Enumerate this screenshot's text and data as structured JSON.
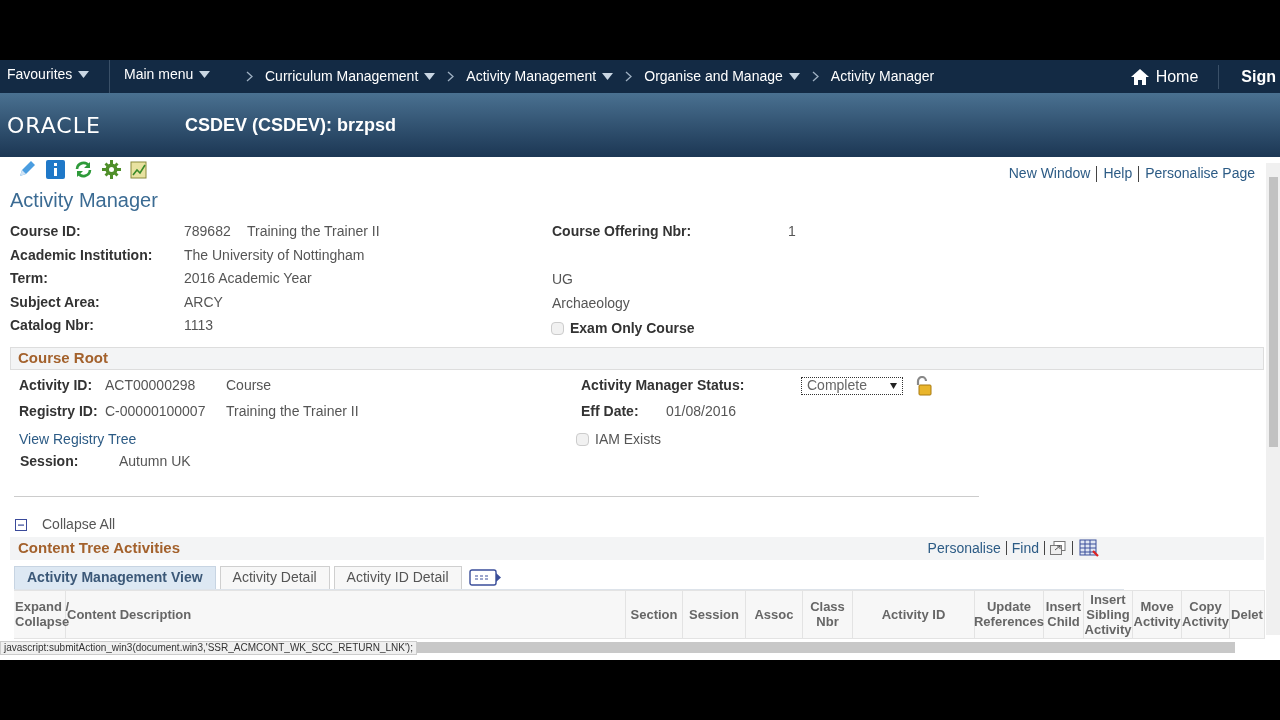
{
  "nav": {
    "menus": [
      {
        "label": "Favourites",
        "dropdown": true
      },
      {
        "label": "Main menu",
        "dropdown": true
      }
    ],
    "breadcrumb": [
      {
        "label": "Curriculum Management",
        "dropdown": true
      },
      {
        "label": "Activity Management",
        "dropdown": true
      },
      {
        "label": "Organise and Manage",
        "dropdown": true
      },
      {
        "label": "Activity Manager",
        "dropdown": false
      }
    ],
    "home": "Home",
    "sign": "Sign"
  },
  "header": {
    "logo": "ORACLE",
    "title": "CSDEV (CSDEV): brzpsd"
  },
  "page_links": [
    "New Window",
    "Help",
    "Personalise Page"
  ],
  "page_title": "Activity Manager",
  "course_fields": [
    {
      "label": "Course ID:",
      "value": "789682",
      "extra": "Training the Trainer II",
      "right_label": "Course Offering Nbr:",
      "right_value": "1"
    },
    {
      "label": "Academic Institution:",
      "value": "The University of Nottingham"
    },
    {
      "label": "Term:",
      "value": "2016 Academic Year",
      "right_text": "UG"
    },
    {
      "label": "Subject Area:",
      "value": "ARCY",
      "right_text": "Archaeology"
    },
    {
      "label": "Catalog Nbr:",
      "value": "1113"
    }
  ],
  "exam_only": {
    "label": "Exam Only Course",
    "checked": false
  },
  "course_root": {
    "title": "Course Root",
    "activity_id": {
      "label": "Activity ID:",
      "value": "ACT00000298",
      "extra": "Course"
    },
    "registry_id": {
      "label": "Registry ID:",
      "value": "C-00000100007",
      "extra": "Training the Trainer II"
    },
    "link": "View Registry Tree",
    "session": {
      "label": "Session:",
      "value": "Autumn UK"
    },
    "status": {
      "label": "Activity Manager Status:",
      "value": "Complete"
    },
    "eff_date": {
      "label": "Eff Date:",
      "value": "01/08/2016"
    },
    "iam_exists": {
      "label": "IAM Exists",
      "checked": false
    }
  },
  "collapse_all": "Collapse All",
  "content_tree": {
    "title": "Content Tree Activities",
    "links": [
      "Personalise",
      "Find"
    ],
    "tabs": [
      {
        "label": "Activity Management View",
        "selected": true
      },
      {
        "label": "Activity Detail",
        "selected": false
      },
      {
        "label": "Activity ID Detail",
        "selected": false
      }
    ],
    "columns": [
      "Expand / Collapse",
      "Content Description",
      "Section",
      "Session",
      "Assoc",
      "Class Nbr",
      "Activity ID",
      "Update References",
      "Insert Child",
      "Insert Sibling Activity",
      "Move Activity",
      "Copy Activity",
      "Delet"
    ]
  },
  "status_bar": "javascript:submitAction_win3(document.win3,'SSR_ACMCONT_WK_SCC_RETURN_LNK');"
}
